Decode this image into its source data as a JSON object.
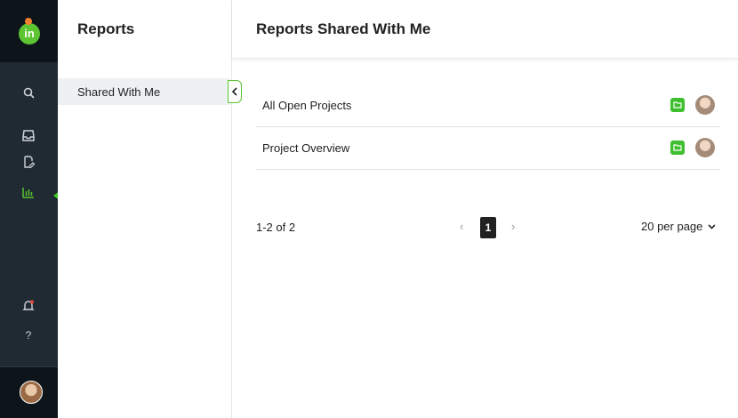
{
  "rail": {
    "logo_text": "in",
    "brand_color": "#5cc531",
    "active_color": "#5cc531",
    "icons": [
      "search-icon",
      "inbox-icon",
      "tasks-icon",
      "reports-icon",
      "notifications-icon",
      "help-icon"
    ],
    "help_label": "?"
  },
  "sidebar": {
    "title": "Reports",
    "items": [
      {
        "label": "Shared With Me",
        "selected": true
      }
    ]
  },
  "main": {
    "title": "Reports Shared With Me",
    "reports": [
      {
        "name": "All Open Projects"
      },
      {
        "name": "Project Overview"
      }
    ],
    "pagination": {
      "count_text": "1-2 of 2",
      "prev": "‹",
      "current_page": "1",
      "next": "›",
      "per_page": "20 per page"
    }
  }
}
